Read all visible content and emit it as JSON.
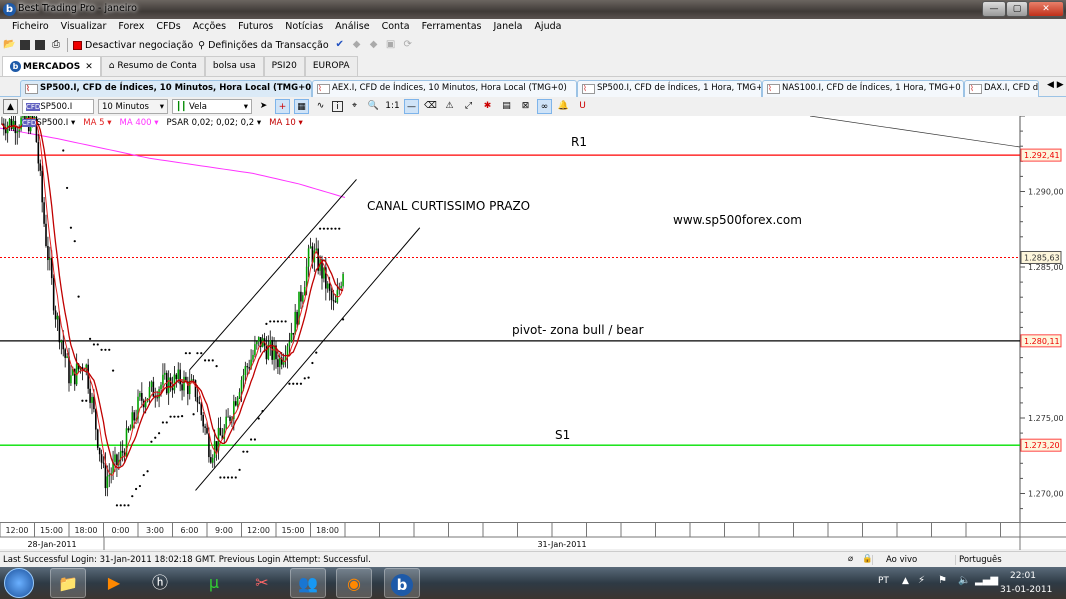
{
  "window": {
    "title": "Best Trading Pro - janeiro",
    "logo": "b",
    "min": "—",
    "max": "▢",
    "close": "✕"
  },
  "menu": [
    "Ficheiro",
    "Visualizar",
    "Forex",
    "CFDs",
    "Acções",
    "Futuros",
    "Notícias",
    "Análise",
    "Conta",
    "Ferramentas",
    "Janela",
    "Ajuda"
  ],
  "toolbar": {
    "disable_trading": "Desactivar negociação",
    "transaction_settings": "Definições da Transacção"
  },
  "tabs": [
    {
      "label": "MERCADOS",
      "close": "✕"
    },
    {
      "label": "Resumo de Conta"
    },
    {
      "label": "bolsa usa"
    },
    {
      "label": "PSI20"
    },
    {
      "label": "EUROPA"
    }
  ],
  "chart_tabs": [
    {
      "label": "SP500.I, CFD de Índices, 10 Minutos, Hora Local (TMG+0)",
      "close": "✕"
    },
    {
      "label": "AEX.I, CFD de Índices, 10 Minutos, Hora Local (TMG+0)"
    },
    {
      "label": "SP500.I, CFD de Índices, 1 Hora, TMG+0"
    },
    {
      "label": "NAS100.I, CFD de Índices, 1 Hora, TMG+0"
    },
    {
      "label": "DAX.I, CFD de"
    }
  ],
  "chart_toolbar": {
    "symbol": "SP500.I",
    "timeframe": "10 Minutos",
    "chart_type": "Vela",
    "one_to_one": "1:1"
  },
  "legend": {
    "symbol": "SP500.I ▾",
    "ma5": "MA 5 ▾",
    "ma400": "MA 400 ▾",
    "psar": "PSAR 0,02; 0,02; 0,2 ▾",
    "ma10": "MA 10 ▾"
  },
  "colors": {
    "ma5": "#e02020",
    "ma400": "#ff33ff",
    "ma10": "#c00000",
    "r1": "#ff0000",
    "pivot": "#000000",
    "s1": "#00e000",
    "current": "#ff0000"
  },
  "annotations": {
    "r1": "R1",
    "channel": "CANAL CURTISSIMO PRAZO",
    "website": "www.sp500forex.com",
    "pivot": "pivot- zona bull / bear",
    "s1": "S1"
  },
  "chart_data": {
    "type": "candlestick",
    "ylim": [
      1267.5,
      1295
    ],
    "yticks": [
      "1.290,00",
      "1.285,00",
      "1.275,00",
      "1.270,00"
    ],
    "ytick_values": [
      1290,
      1285,
      1275,
      1270
    ],
    "levels": [
      {
        "name": "R1",
        "value": 1292.41,
        "label": "1.292,41"
      },
      {
        "name": "current",
        "value": 1285.63,
        "label": "1.285,63"
      },
      {
        "name": "pivot",
        "value": 1280.11,
        "label": "1.280,11"
      },
      {
        "name": "S1",
        "value": 1273.2,
        "label": "1.273,20"
      }
    ],
    "xticks": [
      "12:00",
      "15:00",
      "18:00",
      "0:00",
      "3:00",
      "6:00",
      "9:00",
      "12:00",
      "15:00",
      "18:00"
    ],
    "dates": [
      "28-Jan-2011",
      "31-Jan-2011"
    ],
    "close_path_hours": [
      0,
      3,
      3.9,
      4.8,
      6.1,
      7.4,
      9.1,
      10.4,
      12.2,
      13.9,
      15.7,
      17,
      18.3,
      19.6,
      20.9,
      22.6,
      24.3,
      25.7,
      27,
      27.8,
      29.1,
      30
    ],
    "close_path": [
      1294.5,
      1294.7,
      1287.4,
      1282.1,
      1277.5,
      1278.8,
      1270.9,
      1272.2,
      1276.2,
      1277.2,
      1277.5,
      1276.8,
      1272.8,
      1274.2,
      1277.5,
      1280.1,
      1278.8,
      1281.5,
      1286.1,
      1285.1,
      1282.1,
      1285.6
    ],
    "ma400_hours": [
      0,
      5,
      13,
      22,
      26,
      30
    ],
    "ma400": [
      1294.2,
      1293.5,
      1292.2,
      1291.2,
      1290.5,
      1289.6
    ],
    "channel_upper": [
      [
        16.5,
        1278.2
      ],
      [
        31,
        1290.8
      ]
    ],
    "channel_lower": [
      [
        17,
        1270.2
      ],
      [
        36.5,
        1287.6
      ]
    ]
  },
  "status": {
    "login": "Last Successful Login: 31-Jan-2011 18:02:18 GMT. Previous Login Attempt: Successful.",
    "live": "Ao vivo",
    "language": "Português"
  },
  "taskbar": {
    "lang": "PT",
    "time": "22:01",
    "date": "31-01-2011"
  }
}
